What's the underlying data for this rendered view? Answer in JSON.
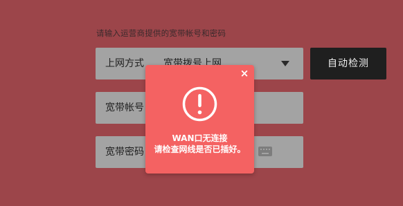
{
  "form": {
    "hint": "请输入运营商提供的宽带帐号和密码",
    "mode": {
      "label": "上网方式",
      "value": "宽带拨号上网"
    },
    "account": {
      "label": "宽带帐号"
    },
    "password": {
      "label": "宽带密码"
    },
    "auto_detect_label": "自动检测"
  },
  "modal": {
    "close_glyph": "×",
    "line1": "WAN口无连接",
    "line2": "请检查网线是否已插好。"
  },
  "icons": {
    "alert": "exclamation-circle-icon",
    "keyboard": "keyboard-icon",
    "chevron": "chevron-down-icon",
    "close": "close-icon"
  },
  "colors": {
    "background": "#9c454a",
    "field": "#a3a3a3",
    "button": "#1f1f1f",
    "modal": "#f46262"
  }
}
